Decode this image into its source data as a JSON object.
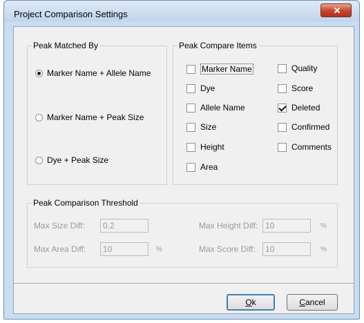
{
  "window": {
    "title": "Project Comparison Settings"
  },
  "peak_matched_by": {
    "title": "Peak Matched By",
    "options": [
      {
        "label": "Marker Name + Allele Name",
        "selected": true
      },
      {
        "label": "Marker Name + Peak Size",
        "selected": false
      },
      {
        "label": "Dye + Peak Size",
        "selected": false
      }
    ]
  },
  "peak_compare_items": {
    "title": "Peak Compare Items",
    "left": [
      {
        "label": "Marker Name",
        "checked": false
      },
      {
        "label": "Dye",
        "checked": false
      },
      {
        "label": "Allele Name",
        "checked": false
      },
      {
        "label": "Size",
        "checked": false
      },
      {
        "label": "Height",
        "checked": false
      },
      {
        "label": "Area",
        "checked": false
      }
    ],
    "right": [
      {
        "label": "Quality",
        "checked": false
      },
      {
        "label": "Score",
        "checked": false
      },
      {
        "label": "Deleted",
        "checked": true
      },
      {
        "label": "Confirmed",
        "checked": false
      },
      {
        "label": "Comments",
        "checked": false
      }
    ]
  },
  "threshold": {
    "title": "Peak Comparison Threshold",
    "max_size_diff_label": "Max Size Diff:",
    "max_size_diff_value": "0.2",
    "max_area_diff_label": "Max Area Diff:",
    "max_area_diff_value": "10",
    "max_area_diff_unit": "%",
    "max_height_diff_label": "Max Height Diff:",
    "max_height_diff_value": "10",
    "max_height_diff_unit": "%",
    "max_score_diff_label": "Max Score Diff:",
    "max_score_diff_value": "10",
    "max_score_diff_unit": "%"
  },
  "buttons": {
    "ok_mnemonic": "O",
    "ok_rest": "k",
    "cancel_mnemonic": "C",
    "cancel_rest": "ancel"
  }
}
